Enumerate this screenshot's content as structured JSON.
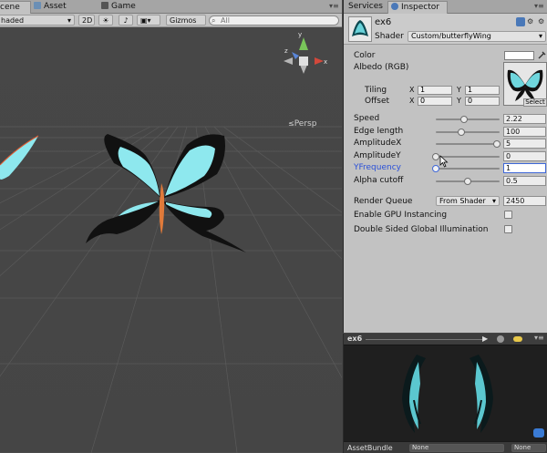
{
  "scene_tabs": {
    "scene": "cene",
    "asset_store": "Asset Store",
    "game": "Game"
  },
  "scene_toolbar": {
    "shading_mode": "haded",
    "mode_2d": "2D",
    "gizmos": "Gizmos",
    "search_placeholder": "All"
  },
  "viewport": {
    "persp_label": "Persp"
  },
  "inspector_tabs": {
    "services": "Services",
    "inspector": "Inspector"
  },
  "material": {
    "name": "ex6",
    "shader_label": "Shader",
    "shader_value": "Custom/butterflyWing"
  },
  "properties": {
    "color_label": "Color",
    "albedo_label": "Albedo (RGB)",
    "tiling_label": "Tiling",
    "offset_label": "Offset",
    "tiling_x": "1",
    "tiling_y": "1",
    "offset_x": "0",
    "offset_y": "0",
    "select_label": "Select",
    "axis_x": "X",
    "axis_y": "Y",
    "sliders": [
      {
        "label": "Speed",
        "value": "2.22",
        "fraction": 0.44,
        "highlight": false,
        "active": false
      },
      {
        "label": "Edge length",
        "value": "100",
        "fraction": 0.4,
        "highlight": false,
        "active": false
      },
      {
        "label": "AmplitudeX",
        "value": "5",
        "fraction": 0.95,
        "highlight": false,
        "active": false
      },
      {
        "label": "AmplitudeY",
        "value": "0",
        "fraction": 0.0,
        "highlight": false,
        "active": false
      },
      {
        "label": "YFrequency",
        "value": "1",
        "fraction": 0.0,
        "highlight": true,
        "active": true
      },
      {
        "label": "Alpha cutoff",
        "value": "0.5",
        "fraction": 0.5,
        "highlight": false,
        "active": false
      }
    ],
    "render_queue_label": "Render Queue",
    "render_queue_mode": "From Shader",
    "render_queue_value": "2450",
    "gpu_instancing_label": "Enable GPU Instancing",
    "double_sided_label": "Double Sided Global Illumination"
  },
  "preview": {
    "title": "ex6"
  },
  "asset_bundle": {
    "label": "AssetBundle",
    "bundle": "None",
    "variant": "None"
  },
  "colors": {
    "panel_bg": "#c2c2c2",
    "scene_bg": "#474747",
    "accent": "#3f68d8",
    "wing_cyan": "#8ee8ee"
  }
}
